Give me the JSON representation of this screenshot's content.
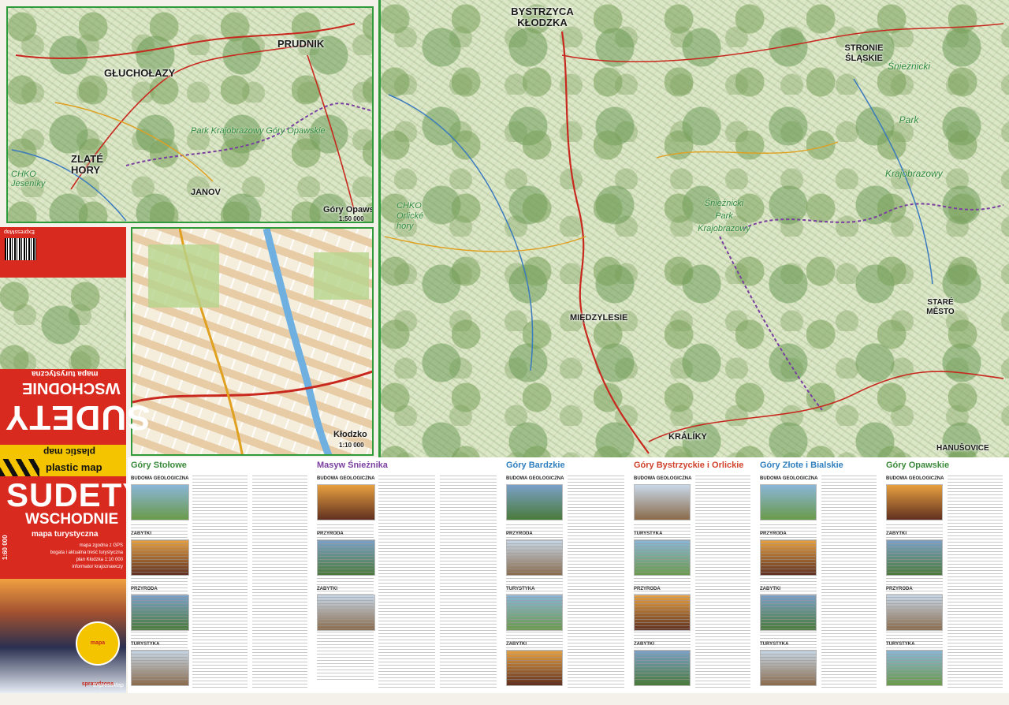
{
  "map_labels": {
    "glucholazy": "GŁUCHOŁAZY",
    "prudnik": "PRUDNIK",
    "zlate_hory": "ZLATÉ HORY",
    "janov": "JANOV",
    "chko_jeseniky": "CHKO Jeseníky",
    "park_gory_opawskie": "Park Krajobrazowy Góry Opawskie",
    "gory_opawskie_inset": "Góry Opawskie",
    "inset_scale": "1:50 000",
    "bystrzyca": "BYSTRZYCA KŁODZKA",
    "stronie": "STRONIE ŚLĄSKIE",
    "miedzylesie": "MIĘDZYLESIE",
    "kraliky": "KRÁLÍKY",
    "stare_mesto": "STARÉ MĚSTO",
    "hanusovice": "HANUŠOVICE",
    "chko_orlicke": "CHKO Orlické hory",
    "snieznicki_park": "Śnieżnicki Park Krajobrazowy",
    "snieznicki_right": "Śnieżnicki Park Krajobrazowy",
    "klodzko": "Kłodzko",
    "klodzko_scale": "1:10 000"
  },
  "cover": {
    "publisher": "ExpressMap",
    "title": "SUDETY",
    "subtitle": "WSCHODNIE",
    "type": "mapa turystyczna",
    "plastic": "plastic map",
    "scale": "1:60 000",
    "features": [
      "mapa zgodna z GPS",
      "bogata i aktualna treść turystyczna",
      "plan Kłodzka 1:10 000",
      "informator krajoznawczy"
    ],
    "sticker": "mapa sprawdzona"
  },
  "sections": [
    {
      "title": "Góry Stołowe",
      "color": "#3a8a3a",
      "subs": [
        "BUDOWA GEOLOGICZNA",
        "ZABYTKI",
        "PRZYRODA",
        "TURYSTYKA"
      ]
    },
    {
      "title": "Masyw Śnieżnika",
      "color": "#7a3fa0",
      "subs": [
        "BUDOWA GEOLOGICZNA",
        "PRZYRODA",
        "ZABYTKI"
      ]
    },
    {
      "title": "Góry Bardzkie",
      "color": "#2f7fbf",
      "subs": [
        "BUDOWA GEOLOGICZNA",
        "PRZYRODA",
        "TURYSTYKA",
        "ZABYTKI"
      ]
    },
    {
      "title": "Góry Bystrzyckie i Orlickie",
      "color": "#d0402a",
      "subs": [
        "BUDOWA GEOLOGICZNA",
        "TURYSTYKA",
        "PRZYRODA",
        "ZABYTKI"
      ]
    },
    {
      "title": "Góry Złote i Bialskie",
      "color": "#2f7fbf",
      "subs": [
        "BUDOWA GEOLOGICZNA",
        "PRZYRODA",
        "ZABYTKI",
        "TURYSTYKA"
      ]
    },
    {
      "title": "Góry Opawskie",
      "color": "#3a8a3a",
      "subs": [
        "BUDOWA GEOLOGICZNA",
        "ZABYTKI",
        "PRZYRODA",
        "TURYSTYKA"
      ]
    }
  ]
}
